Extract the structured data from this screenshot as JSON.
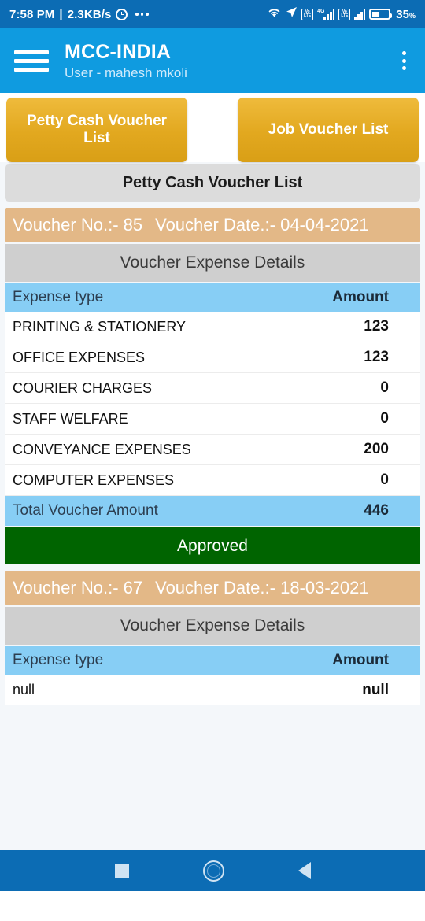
{
  "statusbar": {
    "time": "7:58 PM",
    "separator": "|",
    "network_speed": "2.3KB/s",
    "alarm_icon": "alarm-icon",
    "more_icon": "more-dots-icon",
    "wifi_icon": "wifi-icon",
    "location_icon": "location-arrow-icon",
    "volte1_top": "Vo",
    "volte1_bottom": "LTE",
    "network_type": "4G",
    "volte2_top": "Vo",
    "volte2_bottom": "LTE",
    "battery_icon": "battery-icon",
    "battery_level": "35",
    "battery_unit": "%"
  },
  "appbar": {
    "menu_icon": "hamburger-menu-icon",
    "title": "MCC-INDIA",
    "subtitle": "User - mahesh mkoli",
    "overflow_icon": "kebab-menu-icon"
  },
  "tabs": [
    {
      "label": "Petty Cash Voucher List"
    },
    {
      "label": "Job Voucher List"
    }
  ],
  "page_title": "Petty Cash Voucher List",
  "colors": {
    "statusbar_bg": "#0C6CB4",
    "appbar_bg": "#0F9BE0",
    "tab_gold": "#E2A81F",
    "voucher_head_bg": "#E3B887",
    "section_title_bg": "#CFCFCF",
    "table_head_bg": "#87CEF5",
    "approved_green": "#006400",
    "page_bg": "#F4F7FA"
  },
  "vouchers": [
    {
      "voucher_no_label": "Voucher No.:- 85",
      "voucher_date_label": "Voucher Date.:- 04-04-2021",
      "section_title": "Voucher Expense Details",
      "columns": {
        "expense_type": "Expense type",
        "amount": "Amount"
      },
      "rows": [
        {
          "expense_type": "PRINTING & STATIONERY",
          "amount": "123"
        },
        {
          "expense_type": "OFFICE EXPENSES",
          "amount": "123"
        },
        {
          "expense_type": "COURIER CHARGES",
          "amount": "0"
        },
        {
          "expense_type": "STAFF WELFARE",
          "amount": "0"
        },
        {
          "expense_type": "CONVEYANCE EXPENSES",
          "amount": "200"
        },
        {
          "expense_type": "COMPUTER EXPENSES",
          "amount": "0"
        }
      ],
      "total_label": "Total Voucher Amount",
      "total_amount": "446",
      "status": "Approved"
    },
    {
      "voucher_no_label": "Voucher No.:- 67",
      "voucher_date_label": "Voucher Date.:- 18-03-2021",
      "section_title": "Voucher Expense Details",
      "columns": {
        "expense_type": "Expense type",
        "amount": "Amount"
      },
      "rows": [
        {
          "expense_type": "null",
          "amount": "null"
        }
      ]
    }
  ],
  "navbar": {
    "recents_icon": "square-recents-icon",
    "home_icon": "circle-home-icon",
    "back_icon": "triangle-back-icon"
  }
}
